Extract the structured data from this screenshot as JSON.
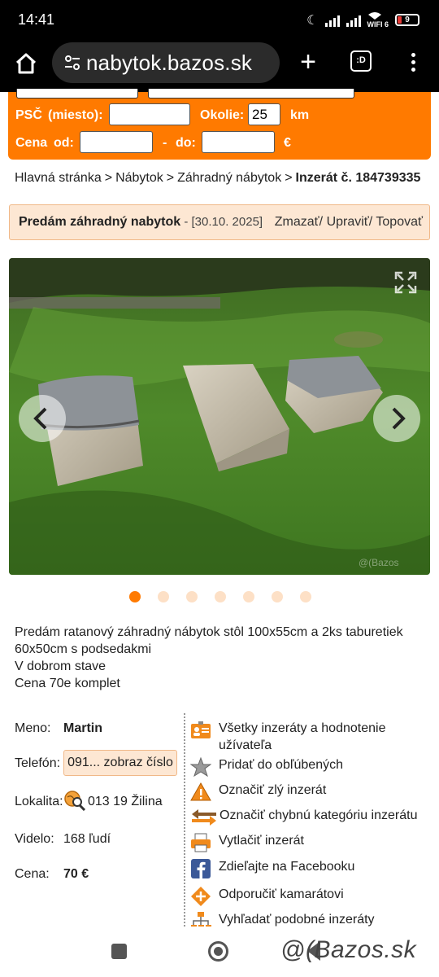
{
  "status": {
    "time": "14:41",
    "wifi_label": "WIFI 6",
    "battery": "9"
  },
  "browser": {
    "url": "nabytok.bazos.sk",
    "tabs_label": ":D"
  },
  "search": {
    "psc_label": "PSČ",
    "miesto_label": "(miesto):",
    "psc_value": "",
    "okolie_label": "Okolie:",
    "okolie_value": "25",
    "km_label": "km",
    "cena_label": "Cena",
    "od_label": "od:",
    "cena_od": "",
    "dash": "-",
    "do_label": "do:",
    "cena_do": "",
    "currency": "€"
  },
  "breadcrumb": {
    "items": [
      "Hlavná stránka",
      "Nábytok",
      "Záhradný nábytok"
    ],
    "separator": ">",
    "current": "Inzerát č. 184739335"
  },
  "listing": {
    "title": "Predám záhradný nabytok",
    "date": " - [30.10. 2025]",
    "actions": "Zmazať/ Upraviť/ Topovať",
    "photo_count": 7,
    "active_photo": 0,
    "description": [
      "Predám ratanový záhradný nábytok stôl 100x55cm a 2ks taburetiek 60x50cm s podsedakmi",
      "V dobrom stave",
      "Cena 70e komplet"
    ]
  },
  "info": {
    "meno_label": "Meno:",
    "meno": "Martin",
    "telefon_label": "Telefón:",
    "telefon_button": "091... zobraz číslo",
    "lokalita_label": "Lokalita:",
    "lokalita": "013 19 Žilina",
    "videlo_label": "Videlo:",
    "videlo": "168 ľudí",
    "cena_label": "Cena:",
    "cena": "70 €"
  },
  "side_actions": [
    {
      "label": "Všetky inzeráty a hodnotenie užívateľa",
      "icon": "user-card-icon"
    },
    {
      "label": "Pridať do obľúbených",
      "icon": "star-icon"
    },
    {
      "label": "Označiť zlý inzerát",
      "icon": "warning-icon"
    },
    {
      "label": "Označiť chybnú kategóriu inzerátu",
      "icon": "swap-arrows-icon"
    },
    {
      "label": "Vytlačiť inzerát",
      "icon": "printer-icon"
    },
    {
      "label": "Zdieľajte na Facebooku",
      "icon": "facebook-icon"
    },
    {
      "label": "Odporučiť kamarátovi",
      "icon": "recommend-icon"
    },
    {
      "label": "Vyhľadať podobné inzeráty",
      "icon": "sitemap-icon"
    }
  ],
  "watermark": "@(Bazos.sk",
  "colors": {
    "accent": "#ff7a00",
    "title_bg": "#fde7d3"
  }
}
